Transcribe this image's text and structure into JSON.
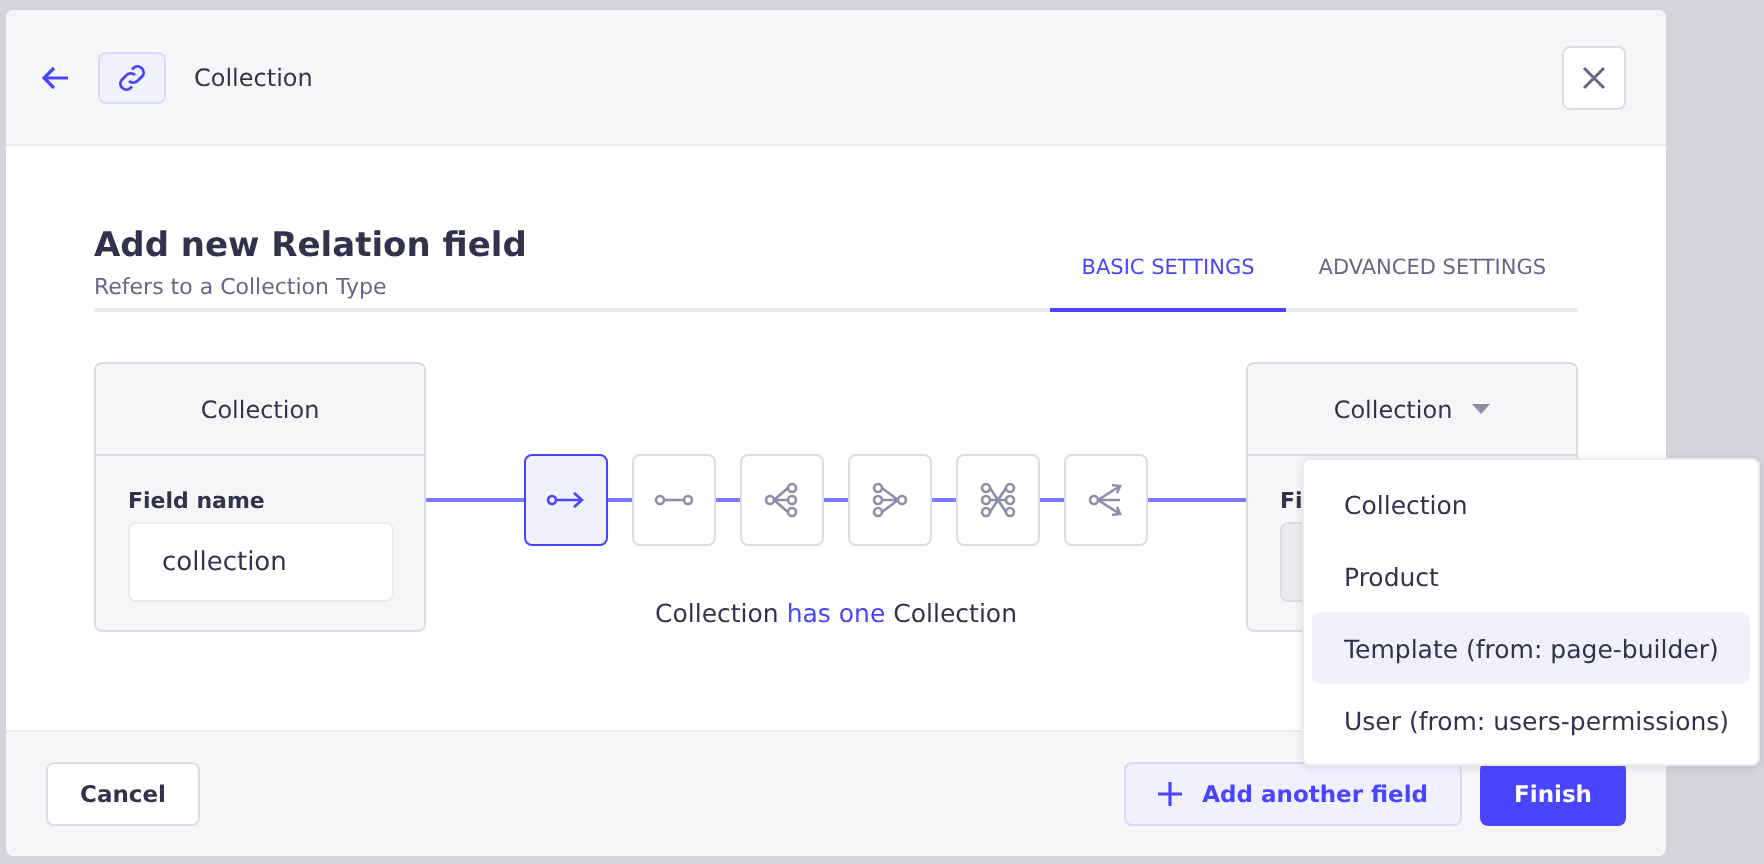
{
  "header": {
    "title": "Collection"
  },
  "heading": {
    "title": "Add new Relation field",
    "subtitle": "Refers to a Collection Type"
  },
  "tabs": [
    {
      "label": "BASIC SETTINGS",
      "selected": true
    },
    {
      "label": "ADVANCED SETTINGS",
      "selected": false
    }
  ],
  "left_card": {
    "title": "Collection",
    "field_label": "Field name",
    "field_value": "collection"
  },
  "relations": [
    {
      "kind": "one-way",
      "selected": true
    },
    {
      "kind": "one-to-one",
      "selected": false
    },
    {
      "kind": "one-to-many",
      "selected": false
    },
    {
      "kind": "many-to-one",
      "selected": false
    },
    {
      "kind": "many-to-many",
      "selected": false
    },
    {
      "kind": "many-way",
      "selected": false
    }
  ],
  "sentence": {
    "left": "Collection",
    "relation": "has one",
    "right": "Collection"
  },
  "right_card": {
    "title": "Collection",
    "field_label": "Fi"
  },
  "dropdown": [
    {
      "label": "Collection",
      "selected": false
    },
    {
      "label": "Product",
      "selected": false
    },
    {
      "label": "Template (from: page-builder)",
      "selected": true
    },
    {
      "label": "User (from: users-permissions)",
      "selected": false
    }
  ],
  "footer": {
    "cancel": "Cancel",
    "add": "Add another field",
    "finish": "Finish"
  }
}
